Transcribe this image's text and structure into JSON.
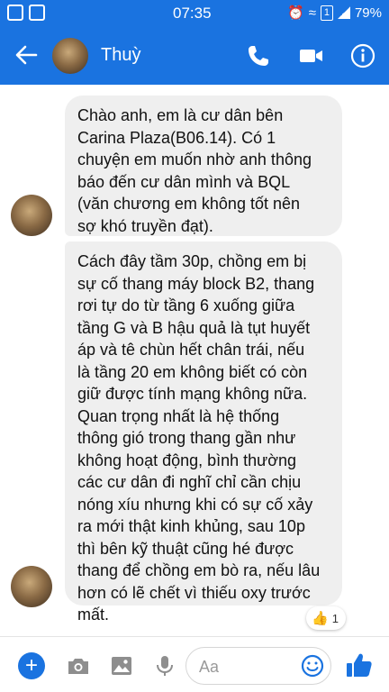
{
  "status_bar": {
    "time": "07:35",
    "battery": "79%",
    "sim_label": "1"
  },
  "header": {
    "contact_name": "Thuỳ"
  },
  "messages": [
    {
      "text": "Chào anh, em là cư dân bên\nCarina Plaza(B06.14). Có 1\nchuyện em muốn nhờ anh thông\nbáo đến cư dân mình và BQL\n(văn chương em không tốt nên\nsợ khó truyền đạt)."
    },
    {
      "text": "Cách đây tầm 30p, chồng em bị\nsự cố thang máy block B2, thang\nrơi tự do từ tầng 6 xuống giữa\ntầng G và B hậu quả là tụt huyết\náp và tê chùn hết chân trái, nếu\nlà tầng 20 em không biết có còn\ngiữ được tính mạng không nữa.\nQuan trọng nhất là hệ thống\nthông gió trong thang gần như\nkhông hoạt động, bình thường\ncác cư dân đi nghĩ chỉ cần chịu\nnóng xíu nhưng khi có sự cố xảy\nra mới thật kinh khủng, sau 10p\nthì bên kỹ thuật cũng hé được\nthang để chồng em bò ra, nếu lâu\nhơn có lẽ chết vì thiếu oxy trước\nmất.",
      "reaction_icon": "thumbs-up",
      "reaction_count": "1"
    }
  ],
  "composer": {
    "placeholder": "Aa"
  },
  "colors": {
    "brand": "#1a73e0",
    "bubble": "#efefef"
  }
}
